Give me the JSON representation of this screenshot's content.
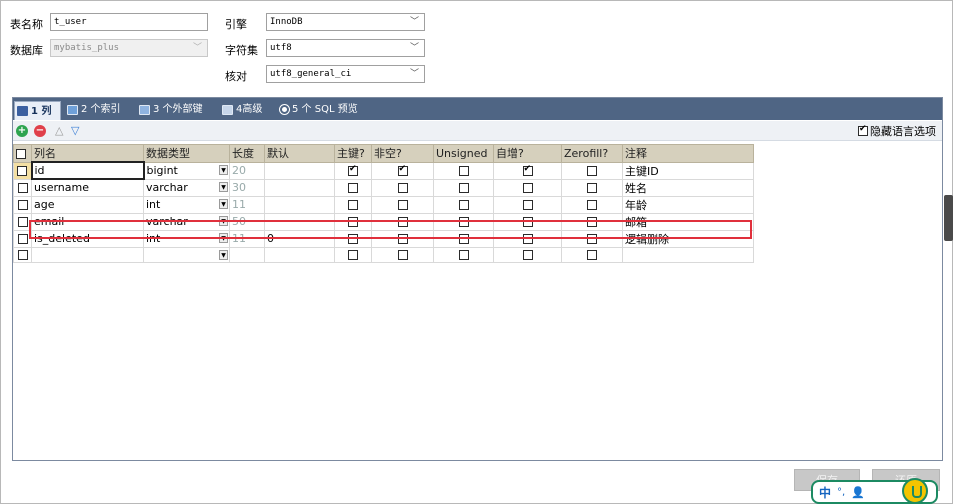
{
  "form": {
    "table_name_label": "表名称",
    "table_name_value": "t_user",
    "database_label": "数据库",
    "database_value": "mybatis_plus",
    "engine_label": "引擎",
    "engine_value": "InnoDB",
    "charset_label": "字符集",
    "charset_value": "utf8",
    "collation_label": "核对",
    "collation_value": "utf8_general_ci"
  },
  "tabs": [
    {
      "label": "1 列",
      "icon": "columns-icon",
      "active": true
    },
    {
      "label": "2 个索引",
      "icon": "index-icon"
    },
    {
      "label": "3 个外部键",
      "icon": "foreign-key-icon"
    },
    {
      "label": "4高级",
      "icon": "advanced-icon"
    },
    {
      "label": "5 个 SQL 预览",
      "icon": "sql-preview-icon"
    }
  ],
  "toolbar": {
    "add_icon": "add-row-icon",
    "remove_icon": "remove-row-icon",
    "up_icon": "move-up-icon",
    "down_icon": "move-down-icon",
    "hide_lang_option": "隐藏语言选项",
    "hide_lang_checked": true
  },
  "grid": {
    "headers": [
      "列名",
      "数据类型",
      "长度",
      "默认",
      "主键?",
      "非空?",
      "Unsigned",
      "自增?",
      "Zerofill?",
      "注释"
    ],
    "rows": [
      {
        "name": "id",
        "type": "bigint",
        "length": "20",
        "default": "",
        "pk": true,
        "notnull": true,
        "unsigned": false,
        "autoinc": true,
        "zerofill": false,
        "comment": "主键ID"
      },
      {
        "name": "username",
        "type": "varchar",
        "length": "30",
        "default": "",
        "pk": false,
        "notnull": false,
        "unsigned": false,
        "autoinc": false,
        "zerofill": false,
        "comment": "姓名"
      },
      {
        "name": "age",
        "type": "int",
        "length": "11",
        "default": "",
        "pk": false,
        "notnull": false,
        "unsigned": false,
        "autoinc": false,
        "zerofill": false,
        "comment": "年龄"
      },
      {
        "name": "email",
        "type": "varchar",
        "length": "50",
        "default": "",
        "pk": false,
        "notnull": false,
        "unsigned": false,
        "autoinc": false,
        "zerofill": false,
        "comment": "邮箱"
      },
      {
        "name": "is_deleted",
        "type": "int",
        "length": "11",
        "default": "0",
        "pk": false,
        "notnull": false,
        "unsigned": false,
        "autoinc": false,
        "zerofill": false,
        "comment": "逻辑删除"
      },
      {
        "name": "",
        "type": "",
        "length": "",
        "default": "",
        "pk": false,
        "notnull": false,
        "unsigned": false,
        "autoinc": false,
        "zerofill": false,
        "comment": ""
      }
    ]
  },
  "buttons": {
    "save": "保存",
    "revert": "还原"
  },
  "ime": {
    "mode": "中",
    "punct": "°,",
    "user_icon": "person-icon",
    "logo_icon": "ime-logo-icon"
  },
  "colors": {
    "tabbar": "#4f6584",
    "header": "#d6d0bd",
    "highlight": "#e0303c"
  }
}
